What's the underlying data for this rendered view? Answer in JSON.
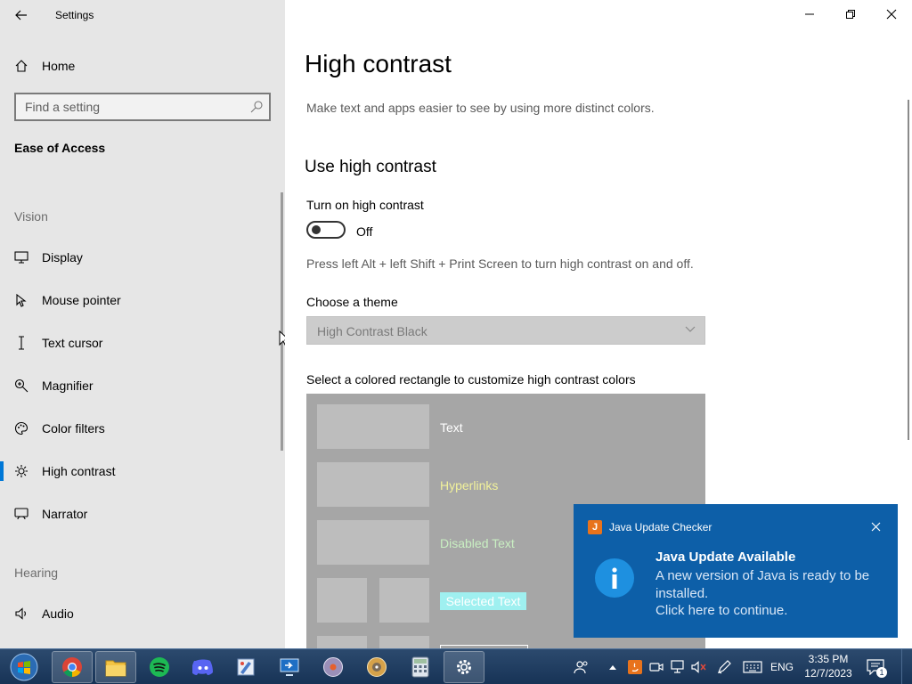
{
  "window": {
    "app_title": "Settings",
    "controls": [
      "minimize",
      "restore",
      "close"
    ]
  },
  "sidebar": {
    "home_label": "Home",
    "search": {
      "placeholder": "Find a setting",
      "value": ""
    },
    "section_title": "Ease of Access",
    "groups": [
      {
        "label": "Vision",
        "items": [
          {
            "label": "Display",
            "icon": "monitor-icon"
          },
          {
            "label": "Mouse pointer",
            "icon": "pointer-icon"
          },
          {
            "label": "Text cursor",
            "icon": "text-cursor-icon"
          },
          {
            "label": "Magnifier",
            "icon": "magnifier-icon"
          },
          {
            "label": "Color filters",
            "icon": "palette-icon"
          },
          {
            "label": "High contrast",
            "icon": "sun-icon",
            "active": true
          },
          {
            "label": "Narrator",
            "icon": "narrator-icon"
          }
        ]
      },
      {
        "label": "Hearing",
        "items": [
          {
            "label": "Audio",
            "icon": "speaker-icon"
          }
        ]
      }
    ]
  },
  "main": {
    "title": "High contrast",
    "description": "Make text and apps easier to see by using more distinct colors.",
    "section_heading": "Use high contrast",
    "toggle": {
      "label": "Turn on high contrast",
      "state_text": "Off",
      "on": false
    },
    "hint": "Press left Alt + left Shift + Print Screen to turn high contrast on and off.",
    "theme": {
      "label": "Choose a theme",
      "selected": "High Contrast Black",
      "disabled": true
    },
    "colors_label": "Select a colored rectangle to customize high contrast colors",
    "preview": [
      {
        "label": "Text",
        "color": "#ffffff"
      },
      {
        "label": "Hyperlinks",
        "color": "#f2f29b"
      },
      {
        "label": "Disabled Text",
        "color": "#c9efc2"
      },
      {
        "label": "Selected Text",
        "color": "#ffffff",
        "bg": "#9ff0f0"
      }
    ]
  },
  "toast": {
    "app": "Java Update Checker",
    "title": "Java Update Available",
    "body": "A new version of Java is ready to be installed.",
    "link": "Click here to continue."
  },
  "taskbar": {
    "apps": [
      "chrome-icon",
      "file-explorer-icon",
      "spotify-icon",
      "discord-icon",
      "paint-icon",
      "remote-desktop-icon",
      "media-player-icon",
      "disk-icon",
      "calculator-icon",
      "settings-icon"
    ],
    "tray": {
      "language": "ENG"
    },
    "clock": {
      "time": "3:35 PM",
      "date": "12/7/2023"
    },
    "notification_count": "1"
  }
}
